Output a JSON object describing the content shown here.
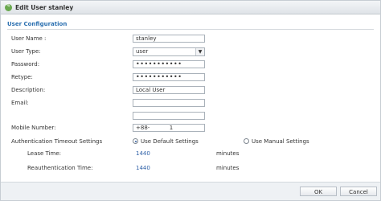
{
  "window": {
    "title": "Edit User stanley"
  },
  "section": {
    "title": "User Configuration"
  },
  "form": {
    "user_name": {
      "label": "User Name :",
      "value": "stanley"
    },
    "user_type": {
      "label": "User Type:",
      "value": "user"
    },
    "password": {
      "label": "Password:",
      "value": "•••••••••••"
    },
    "retype": {
      "label": "Retype:",
      "value": "•••••••••••"
    },
    "description": {
      "label": "Description:",
      "value": "Local User"
    },
    "email": {
      "label": "Email:",
      "value_1": "",
      "value_2": ""
    },
    "mobile": {
      "label": "Mobile Number:",
      "value": "+88-           1"
    }
  },
  "auth_timeout": {
    "label": "Authentication Timeout Settings",
    "use_default": "Use Default Settings",
    "use_manual": "Use Manual Settings",
    "selected": "use_default",
    "lease_time": {
      "label": "Lease Time:",
      "value": "1440",
      "unit": "minutes"
    },
    "reauth_time": {
      "label": "Reauthentication Time:",
      "value": "1440",
      "unit": "minutes"
    }
  },
  "buttons": {
    "ok": "OK",
    "cancel": "Cancel"
  },
  "icons": {
    "title_icon": "edit-icon",
    "select_arrow": "chevron-down-icon"
  },
  "colors": {
    "accent": "#2a6fb0",
    "link": "#2b5ea6",
    "title_icon": "#6aa84f"
  }
}
